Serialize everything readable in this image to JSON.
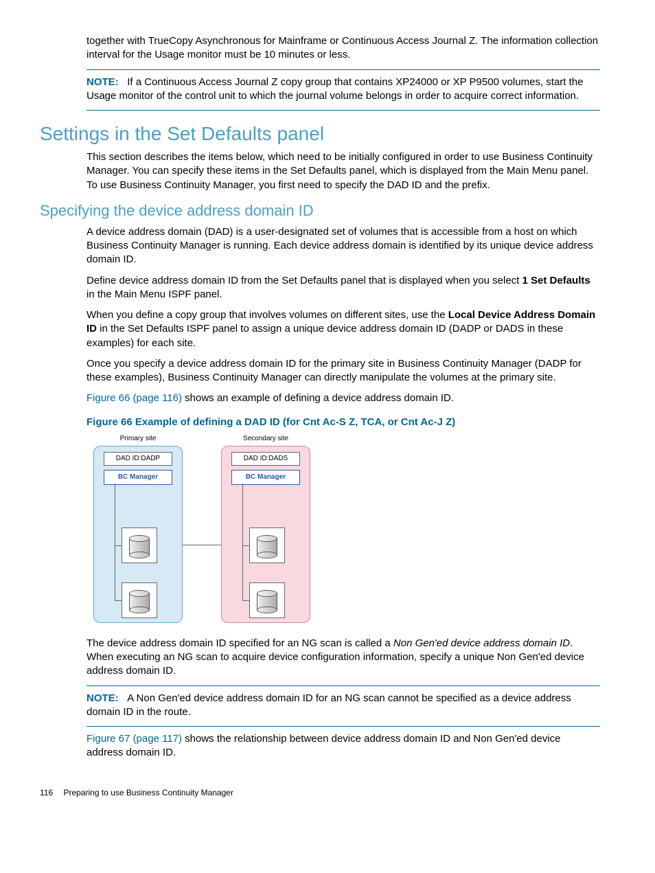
{
  "intro_continuation": "together with TrueCopy Asynchronous for Mainframe or Continuous Access Journal Z. The information collection interval for the Usage monitor must be 10 minutes or less.",
  "note1": {
    "label": "NOTE:",
    "text": "If a Continuous Access Journal Z copy group that contains XP24000 or XP P9500 volumes, start the Usage monitor of the control unit to which the journal volume belongs in order to acquire correct information."
  },
  "h1": "Settings in the Set Defaults panel",
  "h1_body": "This section describes the items below, which need to be initially configured in order to use Business Continuity Manager. You can specify these items in the Set Defaults panel, which is displayed from the Main Menu panel. To use Business Continuity Manager, you first need to specify the DAD ID and the prefix.",
  "h2": "Specifying the device address domain ID",
  "h2_p1": "A device address domain (DAD) is a user-designated set of volumes that is accessible from a host on which Business Continuity Manager is running. Each device address domain is identified by its unique device address domain ID.",
  "h2_p2a": "Define device address domain ID from the Set Defaults panel that is displayed when you select ",
  "h2_p2b": "1 Set Defaults",
  "h2_p2c": " in the Main Menu ISPF panel.",
  "h2_p3a": "When you define a copy group that involves volumes on different sites, use the ",
  "h2_p3b": "Local Device Address Domain ID",
  "h2_p3c": " in the Set Defaults ISPF panel to assign a unique device address domain ID (DADP or DADS in these examples) for each site.",
  "h2_p4": "Once you specify a device address domain ID for the primary site in Business Continuity Manager (DADP for these examples), Business Continuity Manager can directly manipulate the volumes at the primary site.",
  "figref66_link": "Figure 66 (page 116)",
  "figref66_tail": " shows an example of defining a device address domain ID.",
  "figcaption66": "Figure 66 Example of defining a DAD ID (for Cnt Ac-S Z, TCA, or Cnt Ac-J Z)",
  "diagram": {
    "primary_label": "Primary site",
    "secondary_label": "Secondary site",
    "dad_primary": "DAD ID:DADP",
    "dad_secondary": "DAD ID:DADS",
    "bc_label": "BC Manager"
  },
  "after_fig_p1a": "The device address domain ID specified for an NG scan is called a ",
  "after_fig_p1b": "Non Gen'ed device address domain ID",
  "after_fig_p1c": ". When executing an NG scan to acquire device configuration information, specify a unique Non Gen'ed device address domain ID.",
  "note2": {
    "label": "NOTE:",
    "text": "A Non Gen'ed device address domain ID for an NG scan cannot be specified as a device address domain ID in the route."
  },
  "figref67_link": "Figure 67 (page 117)",
  "figref67_tail": " shows the relationship between device address domain ID and Non Gen'ed device address domain ID.",
  "footer": {
    "pagenum": "116",
    "chapter": "Preparing to use Business Continuity Manager"
  }
}
